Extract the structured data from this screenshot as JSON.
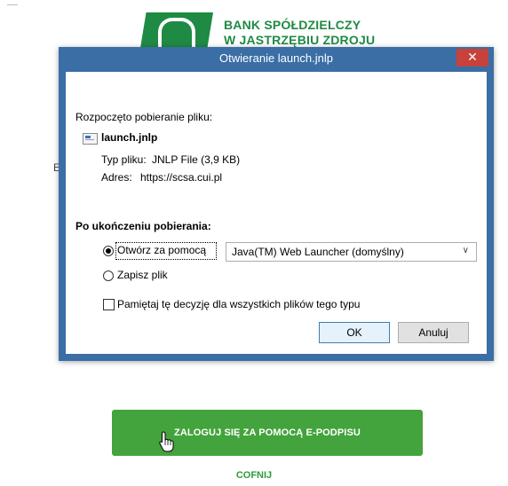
{
  "bank": {
    "name_line1": "BANK SPÓŁDZIELCZY",
    "name_line2": "W JASTRZĘBIU ZDROJU",
    "bg_letter": "E",
    "login_button": "ZALOGUJ SIĘ ZA POMOCĄ E-PODPISU",
    "back_link": "COFNIJ"
  },
  "dialog": {
    "title": "Otwieranie launch.jnlp",
    "close_label": "✕",
    "download_started": "Rozpoczęto pobieranie pliku:",
    "file_name": "launch.jnlp",
    "file_type_label": "Typ pliku:",
    "file_type_value": "JNLP File (3,9 KB)",
    "address_label": "Adres:",
    "address_value": "https://scsa.cui.pl",
    "after_download_label": "Po ukończeniu pobierania:",
    "open_with_label": "Otwórz za pomocą",
    "open_with_app": "Java(TM) Web Launcher (domyślny)",
    "save_file_label": "Zapisz plik",
    "remember_label": "Pamiętaj tę decyzję dla wszystkich plików tego typu",
    "ok_label": "OK",
    "cancel_label": "Anuluj",
    "open_with_selected": true,
    "remember_checked": false
  },
  "colors": {
    "brand_green": "#1f8a43",
    "login_button_green": "#43a33c",
    "dialog_frame": "#3a6ea5",
    "close_red": "#c7423a"
  }
}
